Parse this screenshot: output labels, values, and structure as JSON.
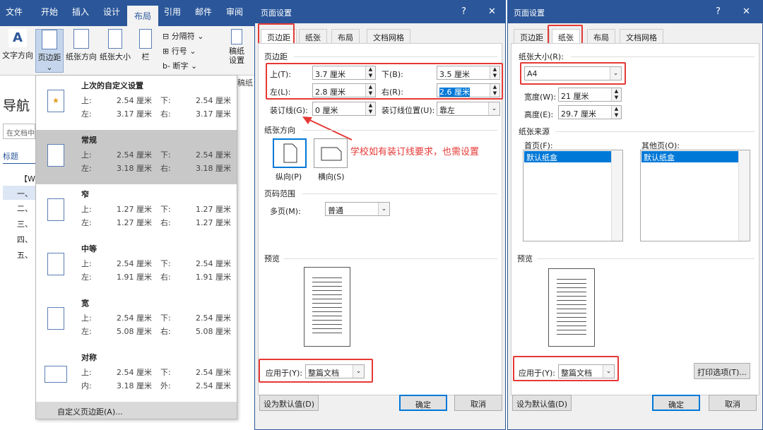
{
  "ribbon": {
    "tabs": [
      "文件",
      "开始",
      "插入",
      "设计",
      "布局",
      "引用",
      "邮件",
      "审阅"
    ],
    "buttons": {
      "text_direction": "文字方向",
      "margins": "页边距",
      "orientation": "纸张方向",
      "size": "纸张大小",
      "columns": "栏",
      "breaks": "分隔符",
      "line_numbers": "行号",
      "hyphenation": "断字",
      "draft": "稿纸\n设置",
      "draft_label": "稿纸"
    }
  },
  "nav": {
    "title": "导航",
    "search_placeholder": "在文档中",
    "headings_tab": "标题",
    "items": [
      "【Wo",
      "一、",
      "二、",
      "三、",
      "四、",
      "五、"
    ]
  },
  "margins_menu": {
    "presets": [
      {
        "name": "上次的自定义设置",
        "top": "2.54 厘米",
        "bottom": "2.54 厘米",
        "left": "3.17 厘米",
        "right": "3.17 厘米",
        "left_label": "左:",
        "right_label": "右:"
      },
      {
        "name": "常规",
        "top": "2.54 厘米",
        "bottom": "2.54 厘米",
        "left": "3.18 厘米",
        "right": "3.18 厘米",
        "left_label": "左:",
        "right_label": "右:"
      },
      {
        "name": "窄",
        "top": "1.27 厘米",
        "bottom": "1.27 厘米",
        "left": "1.27 厘米",
        "right": "1.27 厘米",
        "left_label": "左:",
        "right_label": "右:"
      },
      {
        "name": "中等",
        "top": "2.54 厘米",
        "bottom": "2.54 厘米",
        "left": "1.91 厘米",
        "right": "1.91 厘米",
        "left_label": "左:",
        "right_label": "右:"
      },
      {
        "name": "宽",
        "top": "2.54 厘米",
        "bottom": "2.54 厘米",
        "left": "5.08 厘米",
        "right": "5.08 厘米",
        "left_label": "左:",
        "right_label": "右:"
      },
      {
        "name": "对称",
        "top": "2.54 厘米",
        "bottom": "2.54 厘米",
        "left": "3.18 厘米",
        "right": "2.54 厘米",
        "left_label": "内:",
        "right_label": "外:"
      }
    ],
    "top_label": "上:",
    "bottom_label": "下:",
    "custom": "自定义页边距(A)..."
  },
  "dialog1": {
    "title": "页面设置",
    "tabs": [
      "页边距",
      "纸张",
      "布局",
      "文档网格"
    ],
    "margins_group": "页边距",
    "top_label": "上(T):",
    "top_value": "3.7 厘米",
    "bottom_label": "下(B):",
    "bottom_value": "3.5 厘米",
    "left_label": "左(L):",
    "left_value": "2.8 厘米",
    "right_label": "右(R):",
    "right_value": "2.6 厘米",
    "gutter_label": "装订线(G):",
    "gutter_value": "0 厘米",
    "gutter_pos_label": "装订线位置(U):",
    "gutter_pos_value": "靠左",
    "annotation": "学校如有装订线要求，也需设置",
    "orientation_group": "纸张方向",
    "portrait": "纵向(P)",
    "landscape": "横向(S)",
    "pages_group": "页码范围",
    "multiple_pages_label": "多页(M):",
    "multiple_pages_value": "普通",
    "preview_group": "预览",
    "apply_label": "应用于(Y):",
    "apply_value": "整篇文档",
    "set_default": "设为默认值(D)",
    "ok": "确定",
    "cancel": "取消",
    "help": "?",
    "close": "✕"
  },
  "dialog2": {
    "title": "页面设置",
    "tabs": [
      "页边距",
      "纸张",
      "布局",
      "文档网格"
    ],
    "size_group": "纸张大小(R):",
    "size_value": "A4",
    "width_label": "宽度(W):",
    "width_value": "21 厘米",
    "height_label": "高度(E):",
    "height_value": "29.7 厘米",
    "source_group": "纸张来源",
    "first_page_label": "首页(F):",
    "first_page_item": "默认纸盒",
    "other_pages_label": "其他页(O):",
    "other_pages_item": "默认纸盒",
    "preview_group": "预览",
    "apply_label": "应用于(Y):",
    "apply_value": "整篇文档",
    "print_options": "打印选项(T)...",
    "set_default": "设为默认值(D)",
    "ok": "确定",
    "cancel": "取消",
    "help": "?",
    "close": "✕"
  },
  "colors": {
    "accent": "#2b579a",
    "highlight": "#e53935",
    "selection": "#0078d7"
  }
}
